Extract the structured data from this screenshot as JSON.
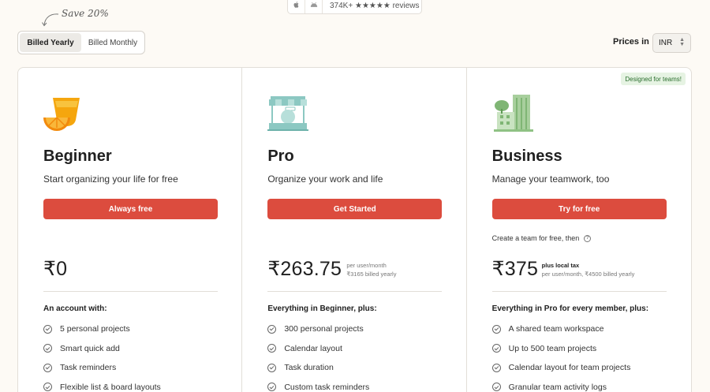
{
  "reviews": {
    "apple_icon": "apple-icon",
    "android_icon": "android-icon",
    "text": "374K+ ★★★★★ reviews"
  },
  "billing": {
    "save_note": "Save 20%",
    "yearly": "Billed Yearly",
    "monthly": "Billed Monthly",
    "selected": "Billed Yearly"
  },
  "currency": {
    "label": "Prices in",
    "value": "INR"
  },
  "colors": {
    "accent": "#dc4c3e",
    "badge_bg": "#e6f3e3",
    "badge_text": "#2b6e2e",
    "page_bg": "#fdfaf5"
  },
  "plans": [
    {
      "name": "Beginner",
      "description": "Start organizing your life for free",
      "cta": "Always free",
      "price": "₹0",
      "features_heading": "An account with:",
      "features": [
        "5 personal projects",
        "Smart quick add",
        "Task reminders",
        "Flexible list & board layouts"
      ]
    },
    {
      "name": "Pro",
      "description": "Organize your work and life",
      "cta": "Get Started",
      "price": "₹263.75",
      "price_line1": "per user/month",
      "price_line2": "₹3165 billed yearly",
      "features_heading": "Everything in Beginner, plus:",
      "features": [
        "300 personal projects",
        "Calendar layout",
        "Task duration",
        "Custom task reminders"
      ]
    },
    {
      "name": "Business",
      "badge": "Designed for teams!",
      "description": "Manage your teamwork, too",
      "cta": "Try for free",
      "note": "Create a team for free, then",
      "price": "₹375",
      "price_line1": "plus local tax",
      "price_line2": "per user/month, ₹4500 billed yearly",
      "features_heading": "Everything in Pro for every member, plus:",
      "features": [
        "A shared team workspace",
        "Up to 500 team projects",
        "Calendar layout for team projects",
        "Granular team activity logs"
      ]
    }
  ]
}
